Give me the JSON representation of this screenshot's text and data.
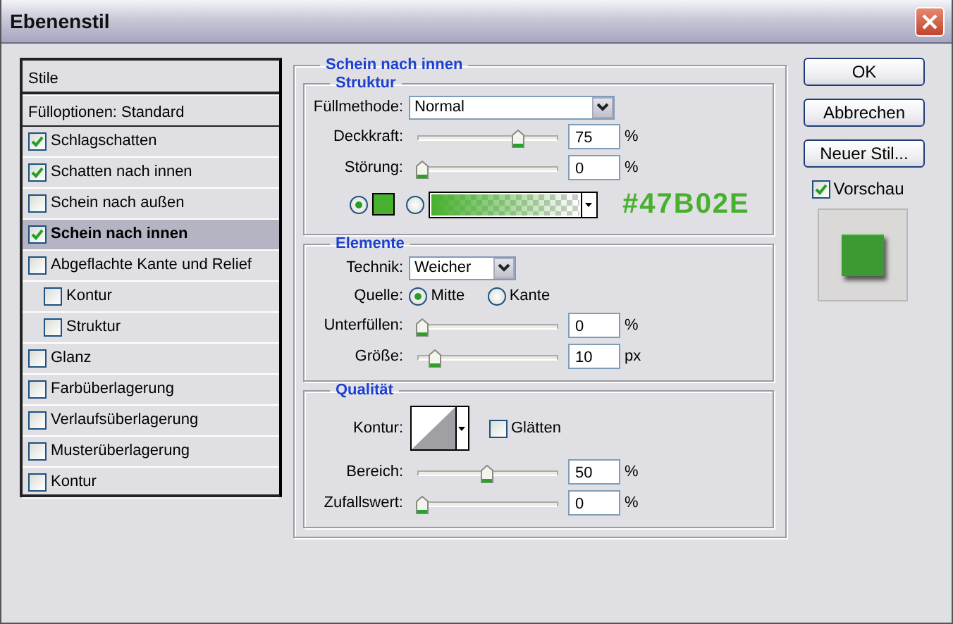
{
  "window": {
    "title": "Ebenenstil"
  },
  "styles_list": {
    "header": "Stile",
    "blending": "Fülloptionen: Standard",
    "items": [
      {
        "label": "Schlagschatten",
        "checked": true,
        "selected": false
      },
      {
        "label": "Schatten nach innen",
        "checked": true,
        "selected": false
      },
      {
        "label": "Schein nach außen",
        "checked": false,
        "selected": false
      },
      {
        "label": "Schein nach innen",
        "checked": true,
        "selected": true
      },
      {
        "label": "Abgeflachte Kante und Relief",
        "checked": false,
        "selected": false,
        "children": [
          {
            "label": "Kontur",
            "checked": false,
            "selected": false
          },
          {
            "label": "Struktur",
            "checked": false,
            "selected": false
          }
        ]
      },
      {
        "label": "Glanz",
        "checked": false,
        "selected": false
      },
      {
        "label": "Farbüberlagerung",
        "checked": false,
        "selected": false
      },
      {
        "label": "Verlaufsüberlagerung",
        "checked": false,
        "selected": false
      },
      {
        "label": "Musterüberlagerung",
        "checked": false,
        "selected": false
      },
      {
        "label": "Kontur",
        "checked": false,
        "selected": false
      }
    ]
  },
  "panel": {
    "title": "Schein nach innen",
    "sections": [
      {
        "title": "Struktur",
        "rows": [
          {
            "kind": "select",
            "label": "Füllmethode:",
            "value": "Normal",
            "wide": true
          },
          {
            "kind": "slider",
            "label": "Deckkraft:",
            "level": 0.75,
            "value": "75",
            "unit": "%"
          },
          {
            "kind": "slider",
            "label": "Störung:",
            "level": 0,
            "value": "0",
            "unit": "%"
          },
          {
            "kind": "fill",
            "options": [
              {
                "kind": "color",
                "selected": true,
                "color": "#47b02e"
              },
              {
                "kind": "gradient",
                "selected": false
              }
            ],
            "hex": "#47B02E"
          }
        ]
      },
      {
        "title": "Elemente",
        "rows": [
          {
            "kind": "select",
            "label": "Technik:",
            "value": "Weicher",
            "wide": false
          },
          {
            "kind": "radio",
            "label": "Quelle:",
            "options": [
              {
                "label": "Mitte",
                "selected": true
              },
              {
                "label": "Kante",
                "selected": false
              }
            ]
          },
          {
            "kind": "slider",
            "label": "Unterfüllen:",
            "level": 0,
            "value": "0",
            "unit": "%"
          },
          {
            "kind": "slider",
            "label": "Größe:",
            "level": 0.1,
            "value": "10",
            "unit": "px"
          }
        ]
      },
      {
        "title": "Qualität",
        "rows": [
          {
            "kind": "contour",
            "label": "Kontur:",
            "checkbox": {
              "label": "Glätten",
              "checked": false
            }
          },
          {
            "kind": "slider",
            "label": "Bereich:",
            "level": 0.5,
            "value": "50",
            "unit": "%"
          },
          {
            "kind": "slider",
            "label": "Zufallswert:",
            "level": 0,
            "value": "0",
            "unit": "%"
          }
        ]
      }
    ]
  },
  "buttons": [
    "OK",
    "Abbrechen",
    "Neuer Stil..."
  ],
  "preview": {
    "label": "Vorschau",
    "checked": true
  }
}
